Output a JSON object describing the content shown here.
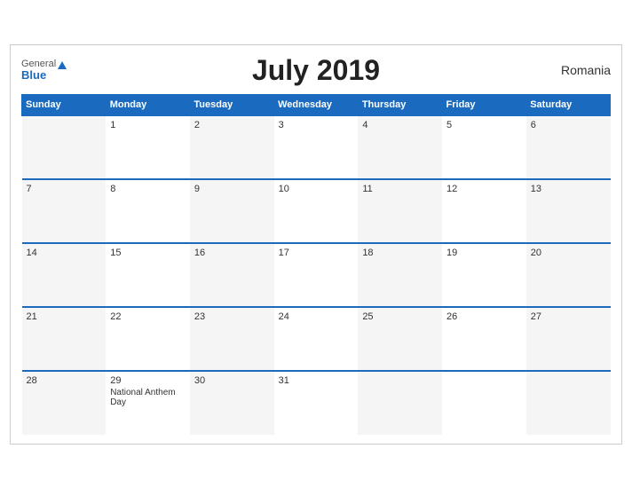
{
  "header": {
    "title": "July 2019",
    "country": "Romania",
    "logo_general": "General",
    "logo_blue": "Blue"
  },
  "weekdays": [
    "Sunday",
    "Monday",
    "Tuesday",
    "Wednesday",
    "Thursday",
    "Friday",
    "Saturday"
  ],
  "weeks": [
    [
      {
        "day": "",
        "event": ""
      },
      {
        "day": "1",
        "event": ""
      },
      {
        "day": "2",
        "event": ""
      },
      {
        "day": "3",
        "event": ""
      },
      {
        "day": "4",
        "event": ""
      },
      {
        "day": "5",
        "event": ""
      },
      {
        "day": "6",
        "event": ""
      }
    ],
    [
      {
        "day": "7",
        "event": ""
      },
      {
        "day": "8",
        "event": ""
      },
      {
        "day": "9",
        "event": ""
      },
      {
        "day": "10",
        "event": ""
      },
      {
        "day": "11",
        "event": ""
      },
      {
        "day": "12",
        "event": ""
      },
      {
        "day": "13",
        "event": ""
      }
    ],
    [
      {
        "day": "14",
        "event": ""
      },
      {
        "day": "15",
        "event": ""
      },
      {
        "day": "16",
        "event": ""
      },
      {
        "day": "17",
        "event": ""
      },
      {
        "day": "18",
        "event": ""
      },
      {
        "day": "19",
        "event": ""
      },
      {
        "day": "20",
        "event": ""
      }
    ],
    [
      {
        "day": "21",
        "event": ""
      },
      {
        "day": "22",
        "event": ""
      },
      {
        "day": "23",
        "event": ""
      },
      {
        "day": "24",
        "event": ""
      },
      {
        "day": "25",
        "event": ""
      },
      {
        "day": "26",
        "event": ""
      },
      {
        "day": "27",
        "event": ""
      }
    ],
    [
      {
        "day": "28",
        "event": ""
      },
      {
        "day": "29",
        "event": "National Anthem Day"
      },
      {
        "day": "30",
        "event": ""
      },
      {
        "day": "31",
        "event": ""
      },
      {
        "day": "",
        "event": ""
      },
      {
        "day": "",
        "event": ""
      },
      {
        "day": "",
        "event": ""
      }
    ]
  ],
  "accent_color": "#1a6bbf"
}
